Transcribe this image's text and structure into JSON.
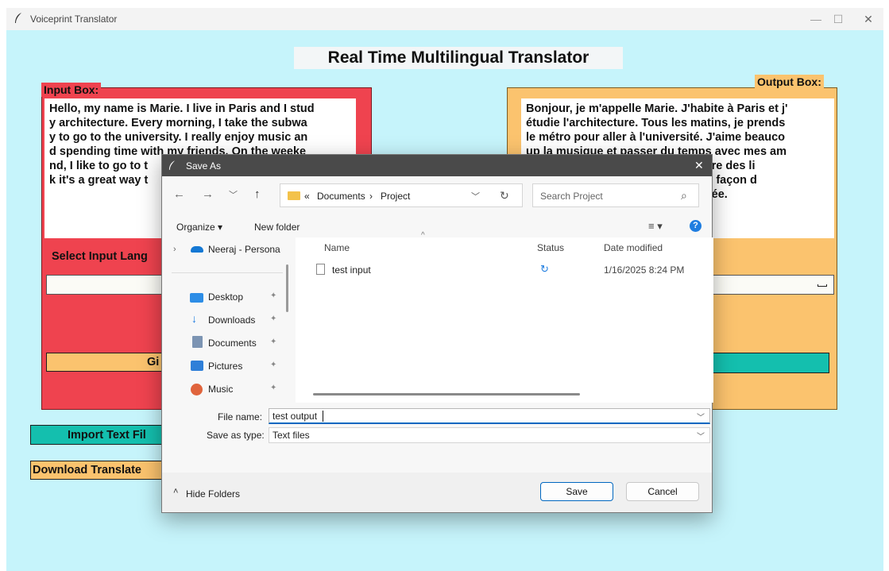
{
  "window": {
    "title": "Voiceprint Translator",
    "minimize": "—",
    "maximize": "☐",
    "close": "✕"
  },
  "app": {
    "heading": "Real Time Multilingual Translator",
    "input_box_label": "Input Box:",
    "output_box_label": "Output Box:",
    "input_text": "Hello, my name is Marie. I live in Paris and I stud\ny architecture. Every morning, I take the subwa\ny to go to the university. I really enjoy music an\nd spending time with my friends. On the weeke\nnd, I like to go to t\nk it's a great way t",
    "output_text": "Bonjour, je m'appelle Marie. J'habite à Paris et j'\nétudie l'architecture. Tous les matins, je prends\nle métro pour aller à l'université. J'aime beauco\nup la musique et passer du temps avec mes am\n                                        u parc et lire des li\n                                         excellente façon d\n                                        aine chargée.",
    "select_input_label": "Select Input Lang",
    "give_button": "Gi",
    "import_button": "Import Text Fil",
    "download_button": "Download Translate"
  },
  "dialog": {
    "title": "Save As",
    "breadcrumb_prefix": "«",
    "breadcrumb_1": "Documents",
    "breadcrumb_sep": "›",
    "breadcrumb_2": "Project",
    "search_placeholder": "Search Project",
    "organize": "Organize ▾",
    "new_folder": "New folder",
    "nav_onedrive": "Neeraj - Persona",
    "nav_items": [
      "Desktop",
      "Downloads",
      "Documents",
      "Pictures",
      "Music"
    ],
    "col_name": "Name",
    "col_status": "Status",
    "col_date": "Date modified",
    "files": [
      {
        "name": "test input",
        "status": "sync-icon",
        "date": "1/16/2025 8:24 PM"
      }
    ],
    "file_name_label": "File name:",
    "file_name_value": "test output",
    "save_type_label": "Save as type:",
    "save_type_value": "Text files",
    "hide_folders": "Hide Folders",
    "save_button": "Save",
    "cancel_button": "Cancel"
  },
  "colors": {
    "background": "#c6f4fb",
    "input_box": "#ef434f",
    "output_box": "#fbc36e",
    "teal": "#14bfae",
    "accent": "#0067c0"
  }
}
